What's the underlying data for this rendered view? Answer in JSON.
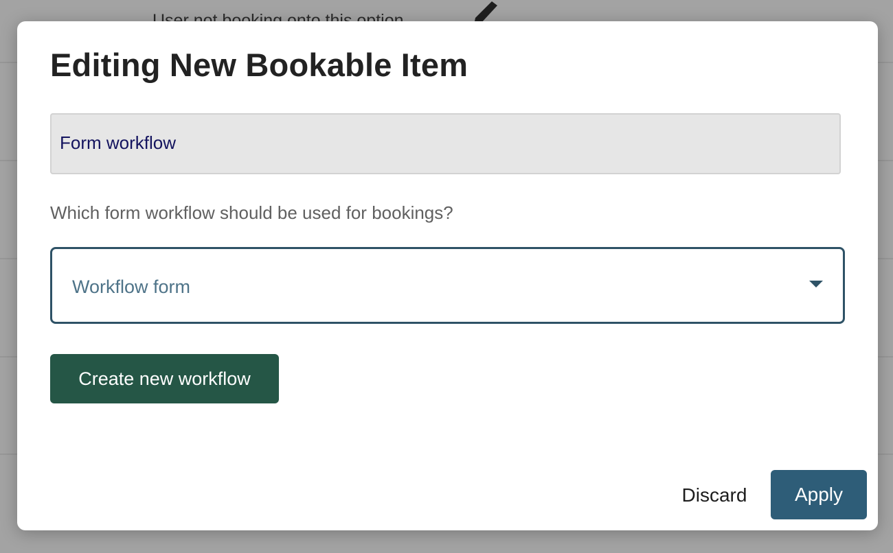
{
  "background": {
    "row_text": "User not booking onto this option",
    "pencil_icon": "pencil-icon"
  },
  "modal": {
    "title": "Editing New Bookable Item",
    "section_label": "Form workflow",
    "question": "Which form workflow should be used for bookings?",
    "select": {
      "value": "Workflow form",
      "caret_icon": "caret-down-icon"
    },
    "create_button": "Create new workflow",
    "discard_button": "Discard",
    "apply_button": "Apply"
  },
  "colors": {
    "create_button_bg": "#255646",
    "apply_button_bg": "#2e5d78",
    "select_border": "#2e5266"
  }
}
